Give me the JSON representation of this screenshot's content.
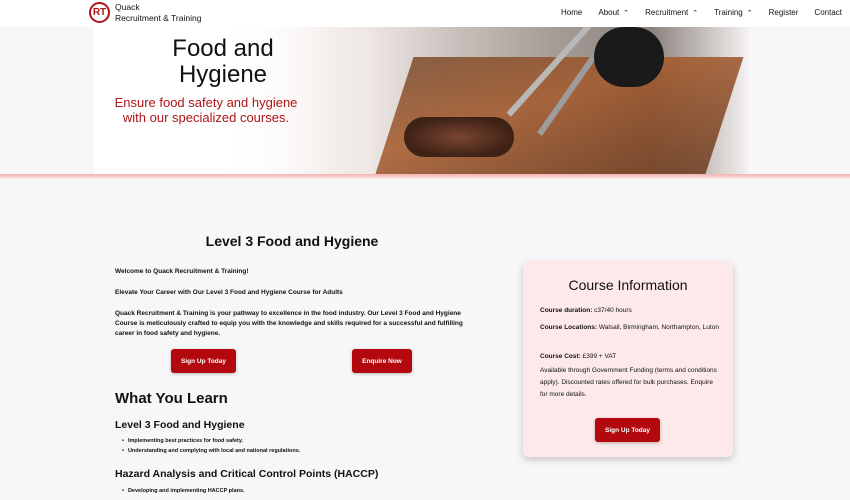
{
  "brand": {
    "logo_text": "RT",
    "name_line1": "Quack",
    "name_line2": "Recruitment & Training"
  },
  "nav": {
    "items": [
      {
        "label": "Home",
        "has_dropdown": false
      },
      {
        "label": "About",
        "has_dropdown": true
      },
      {
        "label": "Recruitment",
        "has_dropdown": true
      },
      {
        "label": "Training",
        "has_dropdown": true
      },
      {
        "label": "Register",
        "has_dropdown": false
      },
      {
        "label": "Contact",
        "has_dropdown": false
      }
    ],
    "chevron": "⌃"
  },
  "hero": {
    "title_line1": "Food and",
    "title_line2": "Hygiene",
    "subtitle_line1": "Ensure food safety and hygiene",
    "subtitle_line2": "with our specialized courses."
  },
  "main": {
    "title": "Level 3 Food and Hygiene",
    "welcome": "Welcome to Quack Recruitment & Training!",
    "elevate": "Elevate Your Career with Our Level 3 Food and Hygiene Course for Adults",
    "body": "Quack Recruitment & Training is your pathway to excellence in the food industry. Our Level 3 Food and Hygiene Course is meticulously crafted to equip you with the knowledge and skills required for a successful and fulfilling career in food safety and hygiene.",
    "signup_label": "Sign Up Today",
    "enquire_label": "Enquire Now",
    "learn_heading": "What You Learn",
    "section1_heading": "Level 3 Food and Hygiene",
    "section1_items": [
      "Implementing best practices for food safety.",
      "Understanding and complying with local and national regulations."
    ],
    "section2_heading": "Hazard Analysis and Critical Control Points (HACCP)",
    "section2_items": [
      "Developing and implementing HACCP plans."
    ]
  },
  "card": {
    "title": "Course Information",
    "duration_label": "Course duration:",
    "duration_value": " c37/40 hours",
    "locations_label": "Course Locations:",
    "locations_value": " Walsall, Birmingham, Northampton, Luton",
    "cost_label": "Course Cost:",
    "cost_value": " £399 + VAT",
    "funding": "Available through Government Funding (terms and conditions apply). Discounted rates offered for bulk purchases. Enquire for more details.",
    "signup_label": "Sign Up Today"
  },
  "colors": {
    "accent": "#b3080d",
    "card_bg": "#fde9e9",
    "hero_sub": "#b01416"
  }
}
